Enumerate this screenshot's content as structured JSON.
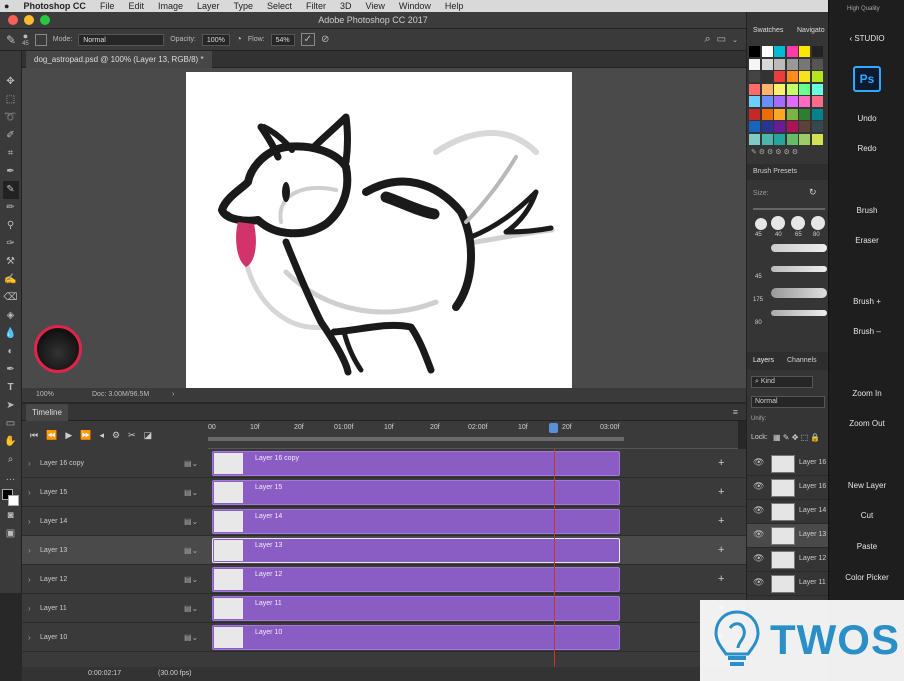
{
  "menubar": {
    "app": "Photoshop CC",
    "items": [
      "File",
      "Edit",
      "Image",
      "Layer",
      "Type",
      "Select",
      "Filter",
      "3D",
      "View",
      "Window",
      "Help"
    ],
    "status": "High Quality"
  },
  "window": {
    "title": "Adobe Photoshop CC 2017"
  },
  "options": {
    "brush_size": "45",
    "mode_label": "Mode:",
    "mode_value": "Normal",
    "opacity_label": "Opacity:",
    "opacity_value": "100%",
    "flow_label": "Flow:",
    "flow_value": "54%"
  },
  "document": {
    "tab": "dog_astropad.psd @ 100% (Layer 13, RGB/8) *",
    "zoom": "100%",
    "doc_info": "Doc: 3.00M/96.5M"
  },
  "timeline": {
    "title": "Timeline",
    "ruler_labels": [
      "00",
      "10f",
      "20f",
      "01:00f",
      "10f",
      "20f",
      "02:00f",
      "10f",
      "20f",
      "03:00f"
    ],
    "timecode": "0:00:02:17",
    "fps": "(30.00 fps)",
    "layers": [
      {
        "name": "Layer 16 copy",
        "clip": "Layer 16 copy"
      },
      {
        "name": "Layer 15",
        "clip": "Layer 15"
      },
      {
        "name": "Layer 14",
        "clip": "Layer 14"
      },
      {
        "name": "Layer 13",
        "clip": "Layer 13"
      },
      {
        "name": "Layer 12",
        "clip": "Layer 12"
      },
      {
        "name": "Layer 11",
        "clip": "Layer 11"
      },
      {
        "name": "Layer 10",
        "clip": "Layer 10"
      }
    ]
  },
  "right_panel": {
    "tabs": [
      "Swatches",
      "Navigato"
    ],
    "brush_presets": {
      "title": "Brush Presets",
      "size_label": "Size:",
      "sizes": [
        "45",
        "40",
        "65",
        "80",
        "45",
        "175",
        "80"
      ]
    },
    "layers_tabs": [
      "Layers",
      "Channels"
    ],
    "kind_label": "Kind",
    "blend_mode": "Normal",
    "lock_label": "Lock:",
    "unify_label": "Unify:",
    "layer_items": [
      "Layer 16",
      "Layer 16",
      "Layer 14",
      "Layer 13",
      "Layer 12",
      "Layer 11"
    ]
  },
  "studio": {
    "back_label": "‹ STUDIO",
    "logo": "Ps",
    "items": [
      "Undo",
      "Redo",
      "Brush",
      "Eraser",
      "Brush +",
      "Brush –",
      "Zoom In",
      "Zoom Out",
      "New Layer",
      "Cut",
      "Paste",
      "Color Picker"
    ]
  },
  "watermark": {
    "text": "TWOS"
  },
  "colors": {
    "clip_purple": "#8a5dc4",
    "playhead": "#c0392b",
    "brush_ring": "#e0244a",
    "tongue": "#d2336b"
  }
}
